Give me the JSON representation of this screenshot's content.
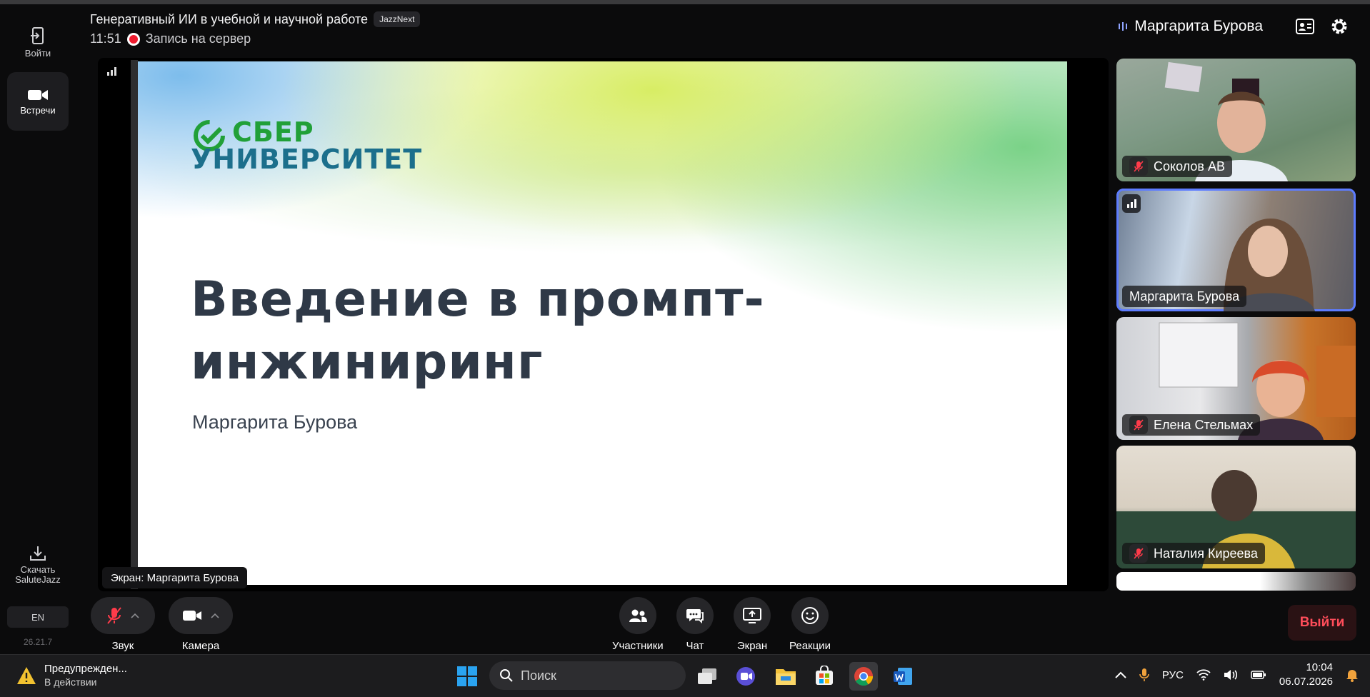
{
  "header": {
    "title": "Генеративный ИИ в учебной и научной работе",
    "badge": "JazzNext",
    "time": "11:51",
    "recording": "Запись на сервер",
    "active_speaker": "Маргарита Бурова"
  },
  "rail": {
    "login": "Войти",
    "meetings": "Встречи",
    "download_line1": "Скачать",
    "download_line2": "SaluteJazz",
    "lang": "EN",
    "version": "26.21.7"
  },
  "slide": {
    "logo_line1": "СБЕР",
    "logo_line2": "УНИВЕРСИТЕТ",
    "title": "Введение в промпт-инжиниринг",
    "author": "Маргарита Бурова"
  },
  "screen_label": "Экран: Маргарита Бурова",
  "participants": [
    {
      "name": "Соколов АВ",
      "muted": true
    },
    {
      "name": "Маргарита Бурова",
      "muted": false
    },
    {
      "name": "Елена Стельмах",
      "muted": true
    },
    {
      "name": "Наталия Киреева",
      "muted": true
    }
  ],
  "controls": {
    "sound": "Звук",
    "camera": "Камера",
    "participants": "Участники",
    "chat": "Чат",
    "screen": "Экран",
    "reactions": "Реакции",
    "exit": "Выйти"
  },
  "taskbar": {
    "warning_title": "Предупрежден...",
    "warning_status": "В действии",
    "search_placeholder": "Поиск",
    "lang": "РУС",
    "time": "10:04",
    "date": "06.07.2026"
  },
  "colors": {
    "accent_red": "#ee1b2e",
    "sber_green": "#21a038",
    "active_tile": "#5d7cff"
  }
}
